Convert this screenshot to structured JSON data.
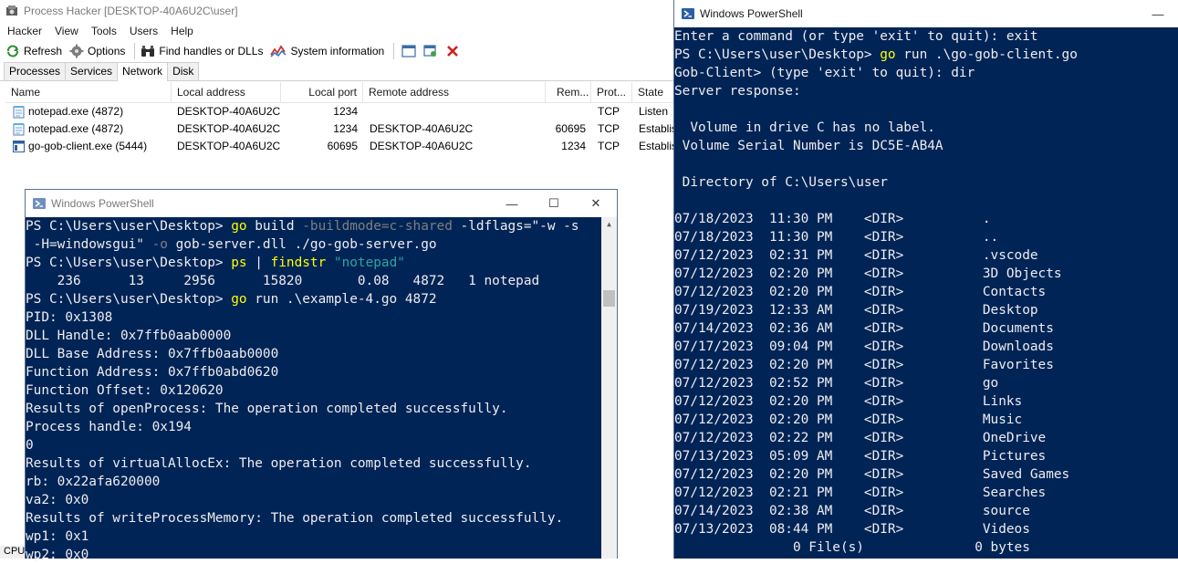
{
  "process_hacker": {
    "title": "Process Hacker [DESKTOP-40A6U2C\\user]",
    "menu": [
      "Hacker",
      "View",
      "Tools",
      "Users",
      "Help"
    ],
    "toolbar": {
      "refresh": "Refresh",
      "options": "Options",
      "find_handles": "Find handles or DLLs",
      "system_info": "System information"
    },
    "tabs": [
      "Processes",
      "Services",
      "Network",
      "Disk"
    ],
    "active_tab": "Network",
    "columns": {
      "name": "Name",
      "local_address": "Local address",
      "local_port": "Local port",
      "remote_address": "Remote address",
      "remote_port": "Rem...",
      "protocol": "Prot...",
      "state": "State"
    },
    "rows": [
      {
        "name": "notepad.exe (4872)",
        "local_address": "DESKTOP-40A6U2C",
        "local_port": "1234",
        "remote_address": "",
        "remote_port": "",
        "protocol": "TCP",
        "state": "Listen",
        "icon": "notepad-icon"
      },
      {
        "name": "notepad.exe (4872)",
        "local_address": "DESKTOP-40A6U2C",
        "local_port": "1234",
        "remote_address": "DESKTOP-40A6U2C",
        "remote_port": "60695",
        "protocol": "TCP",
        "state": "Establis",
        "icon": "notepad-icon"
      },
      {
        "name": "go-gob-client.exe (5444)",
        "local_address": "DESKTOP-40A6U2C",
        "local_port": "60695",
        "remote_address": "DESKTOP-40A6U2C",
        "remote_port": "1234",
        "protocol": "TCP",
        "state": "Establis",
        "icon": "console-app-icon"
      }
    ],
    "status_text": "CPU"
  },
  "ps_left": {
    "title": "Windows PowerShell",
    "controls": {
      "minimize": "—",
      "maximize": "☐",
      "close": "✕"
    }
  },
  "ps_right": {
    "title": "Windows PowerShell",
    "controls": {
      "minimize": "—"
    }
  }
}
